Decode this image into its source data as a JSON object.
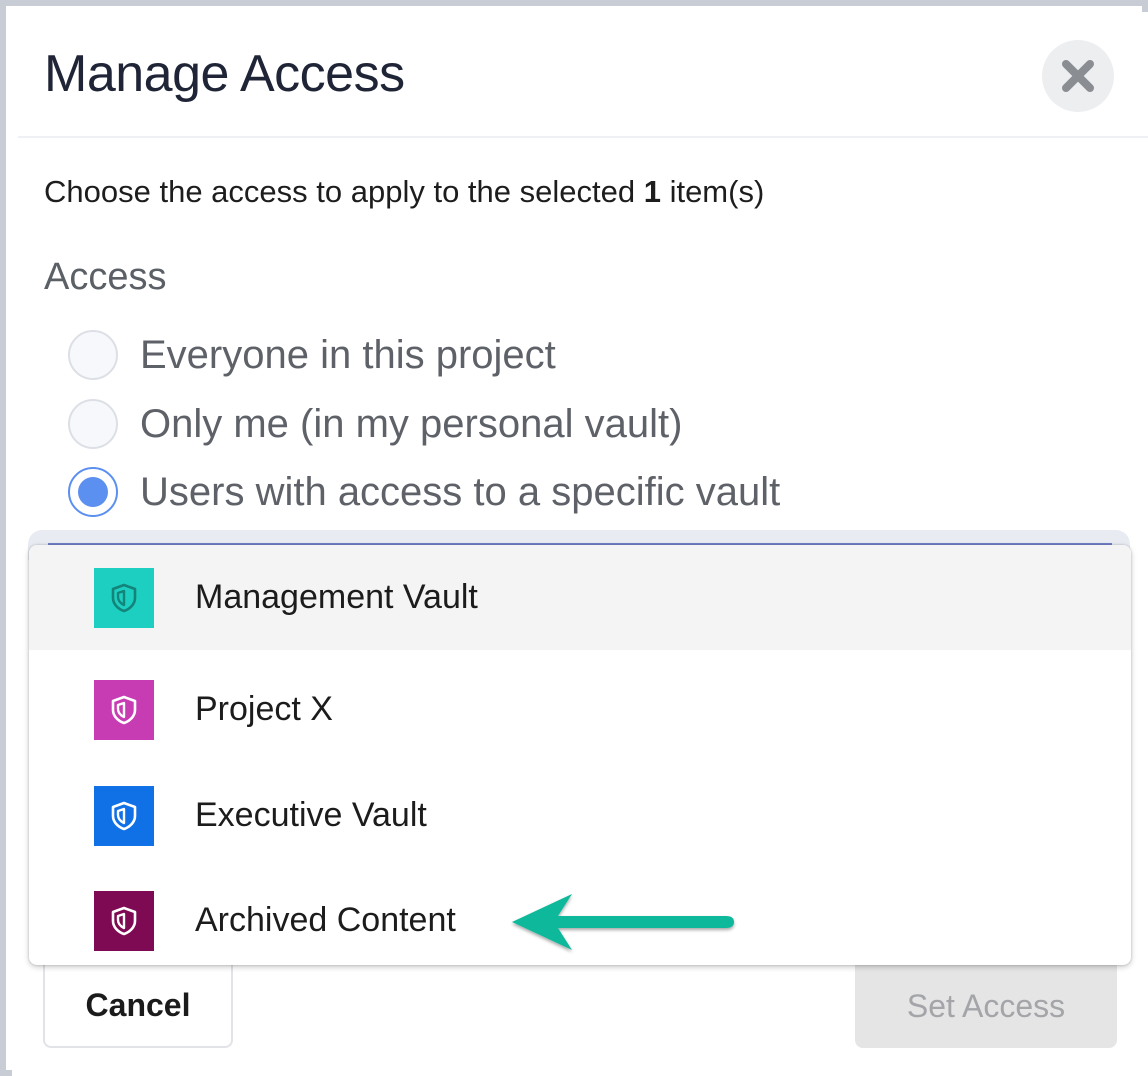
{
  "dialog": {
    "title": "Manage Access",
    "close_icon": "close-icon"
  },
  "description": {
    "prefix": "Choose the access to apply to the selected ",
    "count": "1",
    "suffix": " item(s)"
  },
  "access": {
    "label": "Access",
    "selected_index": 2,
    "options": [
      {
        "label": "Everyone in this project",
        "checked": false
      },
      {
        "label": "Only me (in my personal vault)",
        "checked": false
      },
      {
        "label": "Users with access to a specific vault",
        "checked": true
      }
    ]
  },
  "vault_dropdown": {
    "highlighted_index": 0,
    "options": [
      {
        "label": "Management Vault",
        "color": "#1ccfc0",
        "icon": "shield-icon"
      },
      {
        "label": "Project X",
        "color": "#c83cb3",
        "icon": "shield-icon"
      },
      {
        "label": "Executive Vault",
        "color": "#1070e6",
        "icon": "shield-icon"
      },
      {
        "label": "Archived Content",
        "color": "#7d0a52",
        "icon": "shield-icon"
      }
    ]
  },
  "annotation": {
    "arrow_color": "#10b99a",
    "points_to": "Archived Content"
  },
  "footer": {
    "cancel_label": "Cancel",
    "set_access_label": "Set Access",
    "set_access_disabled": true
  }
}
